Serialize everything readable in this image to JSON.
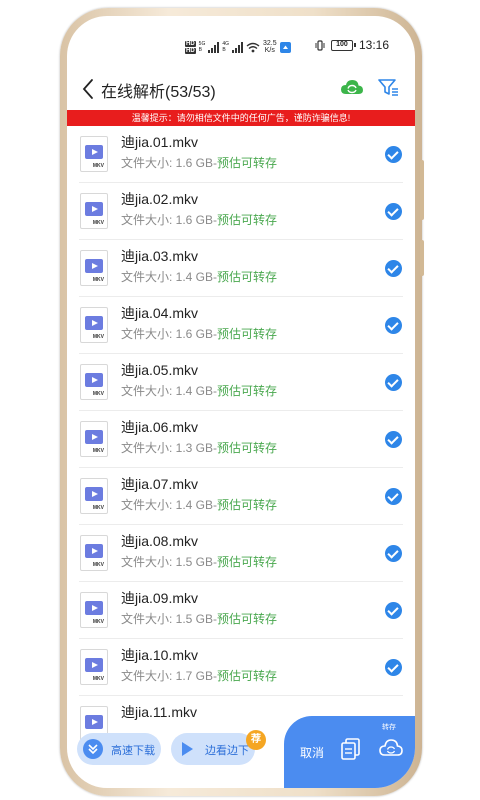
{
  "status_bar": {
    "hd_top": "HD",
    "hd_bottom": "HD",
    "net_type_1": "5G",
    "net_type_2": "4G",
    "sub_1": "B",
    "sub_2": "B",
    "speed_value": "32.5",
    "speed_unit": "K/s",
    "battery": "100",
    "time": "13:16"
  },
  "header": {
    "title": "在线解析(53/53)"
  },
  "warning": "温馨提示：请勿相信文件中的任何广告，谨防诈骗信息!",
  "files": [
    {
      "name": "迪jia.01.mkv",
      "size": "文件大小: 1.6 GB-",
      "tag": "预估可转存",
      "ext": "MKV"
    },
    {
      "name": "迪jia.02.mkv",
      "size": "文件大小: 1.6 GB-",
      "tag": "预估可转存",
      "ext": "MKV"
    },
    {
      "name": "迪jia.03.mkv",
      "size": "文件大小: 1.4 GB-",
      "tag": "预估可转存",
      "ext": "MKV"
    },
    {
      "name": "迪jia.04.mkv",
      "size": "文件大小: 1.6 GB-",
      "tag": "预估可转存",
      "ext": "MKV"
    },
    {
      "name": "迪jia.05.mkv",
      "size": "文件大小: 1.4 GB-",
      "tag": "预估可转存",
      "ext": "MKV"
    },
    {
      "name": "迪jia.06.mkv",
      "size": "文件大小: 1.3 GB-",
      "tag": "预估可转存",
      "ext": "MKV"
    },
    {
      "name": "迪jia.07.mkv",
      "size": "文件大小: 1.4 GB-",
      "tag": "预估可转存",
      "ext": "MKV"
    },
    {
      "name": "迪jia.08.mkv",
      "size": "文件大小: 1.5 GB-",
      "tag": "预估可转存",
      "ext": "MKV"
    },
    {
      "name": "迪jia.09.mkv",
      "size": "文件大小: 1.5 GB-",
      "tag": "预估可转存",
      "ext": "MKV"
    },
    {
      "name": "迪jia.10.mkv",
      "size": "文件大小: 1.7 GB-",
      "tag": "预估可转存",
      "ext": "MKV"
    },
    {
      "name": "迪jia.11.mkv",
      "size": "",
      "tag": "",
      "ext": "MKV"
    }
  ],
  "bottom": {
    "fast_download": "高速下载",
    "watch_while_download": "边看边下",
    "hot_badge": "荐",
    "cancel": "取消",
    "transfer_label": "转存"
  },
  "colors": {
    "accent": "#4b8cf0",
    "check": "#2e86e8",
    "warning": "#e81d1d",
    "tag_green": "#4aa84f",
    "cloud_green": "#3cb54a"
  }
}
